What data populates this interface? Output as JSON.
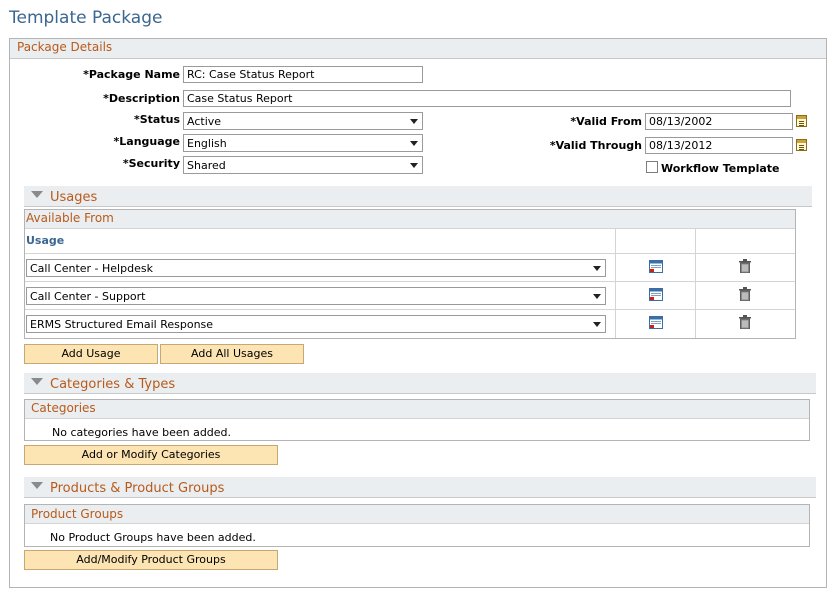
{
  "page": {
    "title": "Template Package"
  },
  "package_details": {
    "header": "Package Details",
    "package_name": {
      "label": "*Package Name",
      "value": "RC: Case Status Report"
    },
    "description": {
      "label": "*Description",
      "value": "Case Status Report"
    },
    "status": {
      "label": "*Status",
      "value": "Active"
    },
    "language": {
      "label": "*Language",
      "value": "English"
    },
    "security": {
      "label": "*Security",
      "value": "Shared"
    },
    "valid_from": {
      "label": "*Valid From",
      "value": "08/13/2002"
    },
    "valid_through": {
      "label": "*Valid Through",
      "value": "08/13/2012"
    },
    "workflow_template": {
      "label": "Workflow Template",
      "checked": false
    }
  },
  "usages": {
    "header": "Usages",
    "grid_title": "Available From",
    "column_usage": "Usage",
    "rows": [
      {
        "usage": "Call Center - Helpdesk"
      },
      {
        "usage": "Call Center - Support"
      },
      {
        "usage": "ERMS Structured Email Response"
      }
    ],
    "add_usage_label": "Add Usage",
    "add_all_usages_label": "Add All Usages"
  },
  "categories": {
    "header": "Categories & Types",
    "grid_title": "Categories",
    "empty_text": "No categories have been added.",
    "button_label": "Add or Modify Categories"
  },
  "products": {
    "header": "Products & Product Groups",
    "grid_title": "Product Groups",
    "empty_text": "No Product Groups have been added.",
    "button_label": "Add/Modify Product Groups"
  },
  "colors": {
    "title": "#3b6690",
    "section_text": "#b85a1b",
    "header_bg": "#eaeef0",
    "button_bg": "#fde4b3"
  }
}
